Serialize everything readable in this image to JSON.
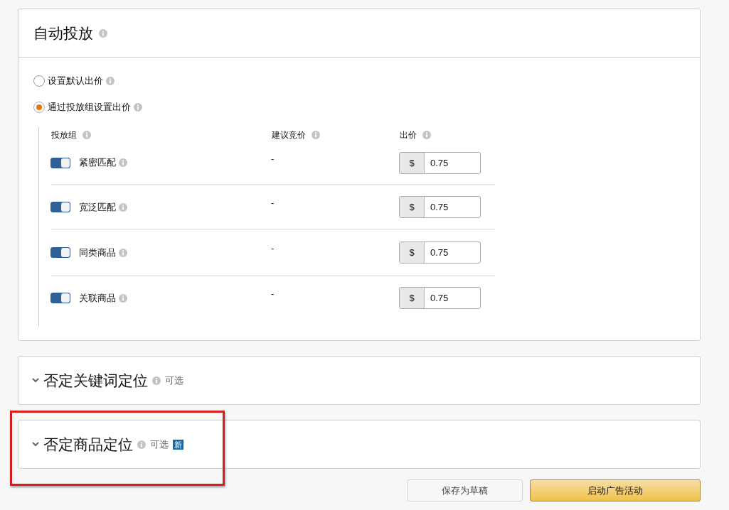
{
  "auto_targeting": {
    "title": "自动投放",
    "bid_options": [
      {
        "label": "设置默认出价",
        "selected": false
      },
      {
        "label": "通过投放组设置出价",
        "selected": true
      }
    ],
    "columns": [
      "投放组",
      "建议竞价",
      "出价"
    ],
    "groups": [
      {
        "name": "紧密匹配",
        "on": true,
        "suggested_bid": "-",
        "currency": "$",
        "bid": "0.75"
      },
      {
        "name": "宽泛匹配",
        "on": true,
        "suggested_bid": "-",
        "currency": "$",
        "bid": "0.75"
      },
      {
        "name": "同类商品",
        "on": true,
        "suggested_bid": "-",
        "currency": "$",
        "bid": "0.75"
      },
      {
        "name": "关联商品",
        "on": true,
        "suggested_bid": "-",
        "currency": "$",
        "bid": "0.75"
      }
    ]
  },
  "sections": [
    {
      "title": "否定关键词定位",
      "optional": "可选",
      "highlighted": false
    },
    {
      "title": "否定商品定位",
      "optional": "可选",
      "badge": "新",
      "highlighted": true
    }
  ],
  "buttons": [
    {
      "label": "保存为草稿",
      "kind": "secondary"
    },
    {
      "label": "启动广告活动",
      "kind": "primary"
    }
  ]
}
